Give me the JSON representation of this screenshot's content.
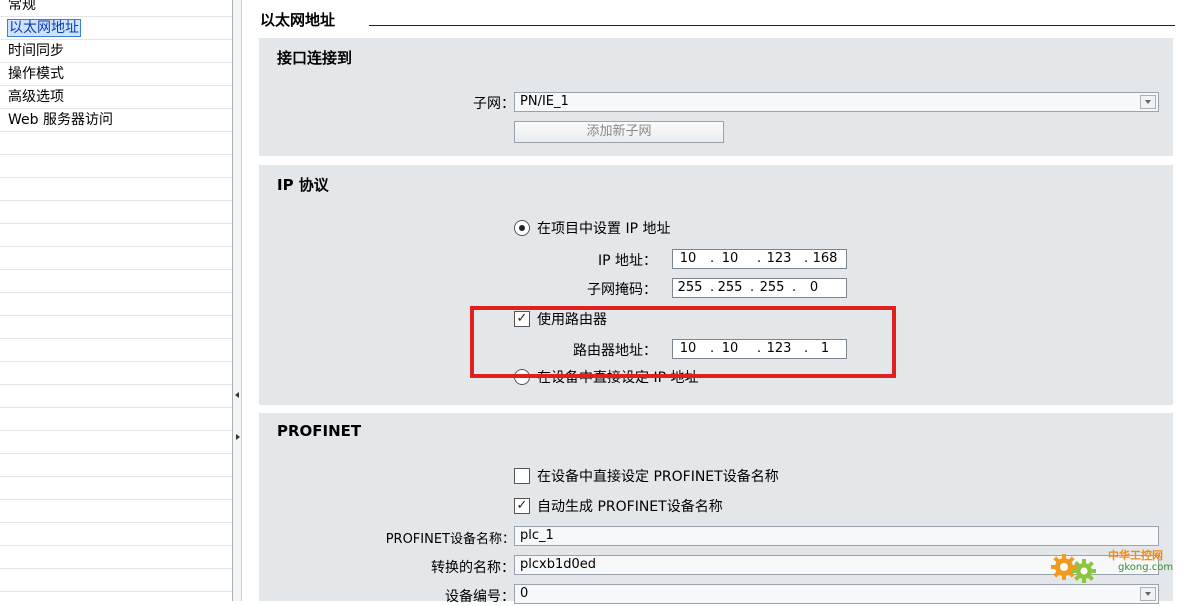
{
  "nav": {
    "items": [
      {
        "label": "常规"
      },
      {
        "label": "以太网地址"
      },
      {
        "label": "时间同步"
      },
      {
        "label": "操作模式"
      },
      {
        "label": "高级选项"
      },
      {
        "label": "Web 服务器访问"
      }
    ]
  },
  "section_title": "以太网地址",
  "interface": {
    "title": "接口连接到",
    "subnet_label": "子网：",
    "subnet_value": "PN/IE_1",
    "add_subnet_button": "添加新子网"
  },
  "ip": {
    "title": "IP 协议",
    "radio_set_in_project": "在项目中设置 IP 地址",
    "ip_label": "IP 地址：",
    "ip_value": [
      "10",
      "10",
      "123",
      "168"
    ],
    "mask_label": "子网掩码：",
    "mask_value": [
      "255",
      "255",
      "255",
      "0"
    ],
    "use_router_label": "使用路由器",
    "router_label": "路由器地址：",
    "router_value": [
      "10",
      "10",
      "123",
      "1"
    ],
    "radio_set_on_device": "在设备中直接设定 IP 地址"
  },
  "profinet": {
    "title": "PROFINET",
    "chk_set_on_device": "在设备中直接设定 PROFINET设备名称",
    "chk_auto_generate": "自动生成 PROFINET设备名称",
    "device_name_label": "PROFINET设备名称：",
    "device_name_value": "plc_1",
    "converted_name_label": "转换的名称：",
    "converted_name_value": "plcxb1d0ed",
    "device_number_label": "设备编号：",
    "device_number_value": "0"
  },
  "state": {
    "use_router_checked": true,
    "set_on_device_checked": false,
    "auto_generate_checked": true,
    "ip_mode": "project"
  },
  "watermark": {
    "line1": "中华工控网",
    "line2": "gkong.com"
  },
  "colors": {
    "highlight": "#e0201f",
    "selected_nav": "#cfe3ff",
    "panel_bg": "#e4e7ea"
  }
}
